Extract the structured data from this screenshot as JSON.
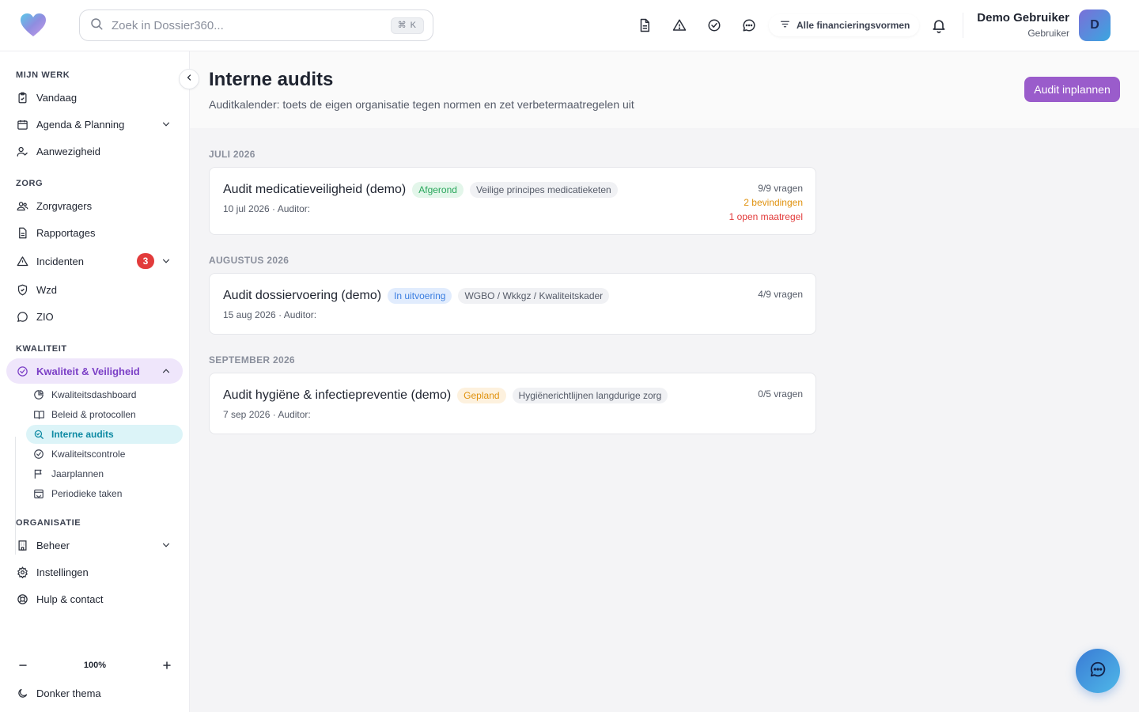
{
  "header": {
    "search_placeholder": "Zoek in Dossier360...",
    "search_shortcut": "⌘ K",
    "financing_filter": "Alle financieringsvormen",
    "user_name": "Demo Gebruiker",
    "user_role": "Gebruiker",
    "avatar_initial": "D"
  },
  "sidebar": {
    "sections": {
      "mijn_werk": "MIJN WERK",
      "zorg": "ZORG",
      "kwaliteit": "KWALITEIT",
      "organisatie": "ORGANISATIE"
    },
    "items": {
      "vandaag": "Vandaag",
      "agenda": "Agenda & Planning",
      "aanwezigheid": "Aanwezigheid",
      "zorgvragers": "Zorgvragers",
      "rapportages": "Rapportages",
      "incidenten": "Incidenten",
      "incidenten_badge": "3",
      "wzd": "Wzd",
      "zio": "ZIO",
      "kwaliteit": "Kwaliteit & Veiligheid",
      "beheer": "Beheer",
      "instellingen": "Instellingen",
      "hulp": "Hulp & contact",
      "donker": "Donker thema"
    },
    "sub_items": {
      "dashboard": "Kwaliteitsdashboard",
      "beleid": "Beleid & protocollen",
      "audits": "Interne audits",
      "controle": "Kwaliteitscontrole",
      "jaarplannen": "Jaarplannen",
      "periodiek": "Periodieke taken"
    },
    "zoom_level": "100%"
  },
  "page": {
    "title": "Interne audits",
    "subtitle": "Auditkalender: toets de eigen organisatie tegen normen en zet verbetermaatregelen uit",
    "cta_label": "Audit inplannen"
  },
  "groups": [
    {
      "month": "JULI 2026",
      "audit": {
        "title": "Audit medicatieveiligheid (demo)",
        "status": "Afgerond",
        "norm": "Veilige principes medicatieketen",
        "date_auditor": "10 jul 2026 · Auditor:",
        "questions": "9/9 vragen",
        "findings": "2 bevindingen",
        "measures": "1 open maatregel"
      }
    },
    {
      "month": "AUGUSTUS 2026",
      "audit": {
        "title": "Audit dossiervoering (demo)",
        "status": "In uitvoering",
        "norm": "WGBO / Wkkgz / Kwaliteitskader",
        "date_auditor": "15 aug 2026 · Auditor:",
        "questions": "4/9 vragen"
      }
    },
    {
      "month": "SEPTEMBER 2026",
      "audit": {
        "title": "Audit hygiëne & infectiepreventie (demo)",
        "status": "Gepland",
        "norm": "Hygiënerichtlijnen langdurige zorg",
        "date_auditor": "7 sep 2026 · Auditor:",
        "questions": "0/5 vragen"
      }
    }
  ],
  "colors": {
    "accent_purple": "#9a5ccb",
    "active_teal": "#0e8aa3",
    "status_done": "#27a65a",
    "status_in_progress": "#3b7ee0",
    "status_planned": "#e0920f",
    "alert_red": "#e23b3b"
  }
}
